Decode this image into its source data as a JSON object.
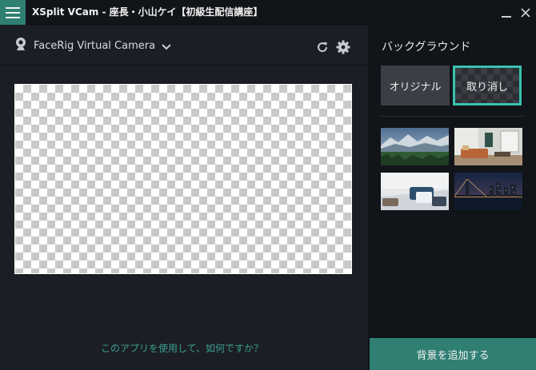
{
  "window": {
    "title": "XSplit VCam - 座長・小山ケイ【初級生配信講座】",
    "menu_icon": "hamburger-icon",
    "minimize_icon": "minimize-icon",
    "close_icon": "close-icon"
  },
  "camera": {
    "name": "FaceRig Virtual Camera",
    "camera_icon": "webcam-icon",
    "dropdown_icon": "chevron-down-icon",
    "refresh_icon": "refresh-icon",
    "settings_icon": "gear-icon"
  },
  "preview": {
    "state": "transparent-checkerboard"
  },
  "help": {
    "link": "このアプリを使用して、如何ですか？"
  },
  "background_panel": {
    "title": "バックグラウンド",
    "original_label": "オリジナル",
    "cancel_label": "取り消し",
    "add_button": "背景を追加する",
    "thumbnails": [
      "mountain-landscape",
      "living-room",
      "bedroom-bed",
      "city-bridge-night"
    ]
  },
  "colors": {
    "accent": "#2f7f73",
    "selected_border": "#39c1b0",
    "link": "#3d9e91",
    "panel_bg": "#111418",
    "main_bg": "#1b1f25"
  }
}
